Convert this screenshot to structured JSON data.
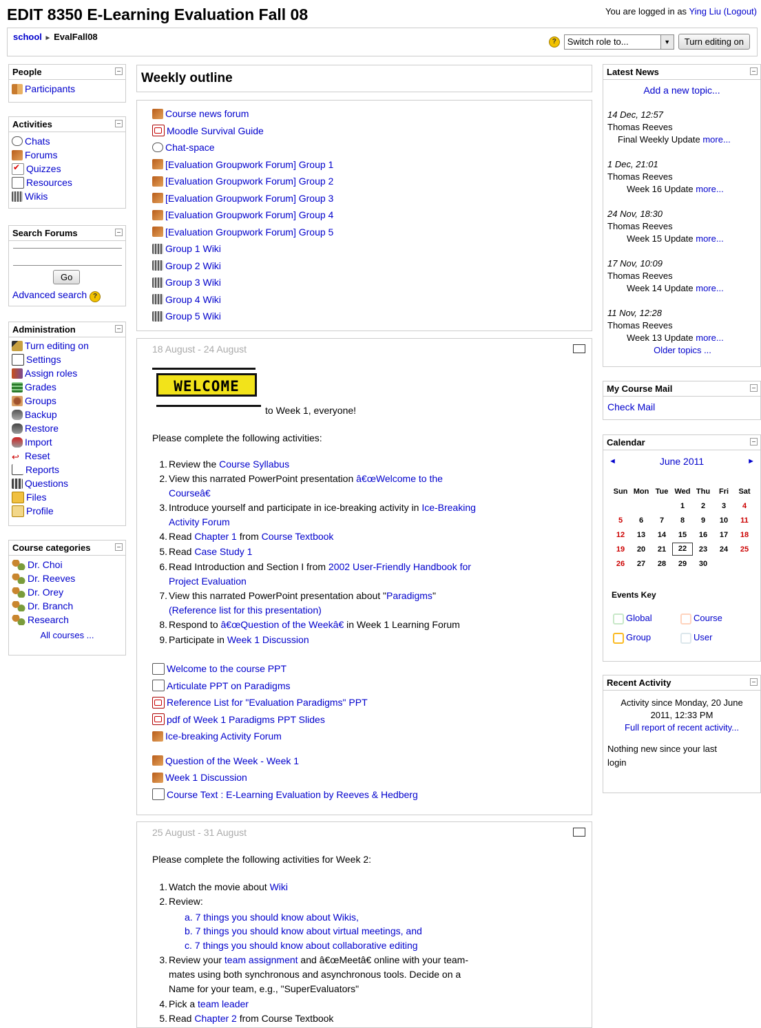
{
  "page": {
    "title": "EDIT 8350 E-Learning Evaluation Fall 08",
    "login_prefix": "You are logged in as",
    "user_name": "Ying Liu",
    "logout_label": "(Logout)"
  },
  "navbar": {
    "breadcrumb_home": "school",
    "breadcrumb_sep": "►",
    "breadcrumb_course": "EvalFall08",
    "help_glyph": "?",
    "switch_role_value": "Switch role to...",
    "turn_editing_label": "Turn editing on"
  },
  "left": {
    "people": {
      "title": "People",
      "items": [
        {
          "label": "Participants",
          "icon": "people-icon"
        }
      ]
    },
    "activities": {
      "title": "Activities",
      "items": [
        {
          "label": "Chats",
          "icon": "chat-icon"
        },
        {
          "label": "Forums",
          "icon": "forum-icon"
        },
        {
          "label": "Quizzes",
          "icon": "quiz-icon"
        },
        {
          "label": "Resources",
          "icon": "resource-icon"
        },
        {
          "label": "Wikis",
          "icon": "wiki-icon"
        }
      ]
    },
    "search": {
      "title": "Search Forums",
      "go_label": "Go",
      "advanced_label": "Advanced search"
    },
    "admin": {
      "title": "Administration",
      "items": [
        {
          "label": "Turn editing on"
        },
        {
          "label": "Settings"
        },
        {
          "label": "Assign roles"
        },
        {
          "label": "Grades"
        },
        {
          "label": "Groups"
        },
        {
          "label": "Backup"
        },
        {
          "label": "Restore"
        },
        {
          "label": "Import"
        },
        {
          "label": "Reset"
        },
        {
          "label": "Reports"
        },
        {
          "label": "Questions"
        },
        {
          "label": "Files"
        },
        {
          "label": "Profile"
        }
      ]
    },
    "categories": {
      "title": "Course categories",
      "items": [
        {
          "label": "Dr. Choi"
        },
        {
          "label": "Dr. Reeves"
        },
        {
          "label": "Dr. Orey"
        },
        {
          "label": "Dr. Branch"
        },
        {
          "label": "Research"
        }
      ],
      "all_label": "All courses ..."
    }
  },
  "main": {
    "outline_title": "Weekly outline",
    "section0": [
      {
        "label": "Course news forum",
        "icon": "forum-icon"
      },
      {
        "label": "Moodle Survival Guide",
        "icon": "pdf-icon"
      },
      {
        "label": "Chat-space",
        "icon": "chat-icon"
      },
      {
        "label": "[Evaluation Groupwork Forum] Group 1",
        "icon": "forum-icon"
      },
      {
        "label": "[Evaluation Groupwork Forum] Group 2",
        "icon": "forum-icon"
      },
      {
        "label": "[Evaluation Groupwork Forum] Group 3",
        "icon": "forum-icon"
      },
      {
        "label": "[Evaluation Groupwork Forum] Group 4",
        "icon": "forum-icon"
      },
      {
        "label": "[Evaluation Groupwork Forum] Group 5",
        "icon": "forum-icon"
      },
      {
        "label": "Group 1 Wiki",
        "icon": "wiki-icon"
      },
      {
        "label": "Group 2 Wiki",
        "icon": "wiki-icon"
      },
      {
        "label": "Group 3 Wiki",
        "icon": "wiki-icon"
      },
      {
        "label": "Group 4 Wiki",
        "icon": "wiki-icon"
      },
      {
        "label": "Group 5 Wiki",
        "icon": "wiki-icon"
      }
    ],
    "week1": {
      "date": "18 August - 24 August",
      "welcome_word": "WELCOME",
      "welcome_text": "to Week 1, everyone!",
      "intro": "Please complete the following activities:",
      "tasks": {
        "t1_pre": "Review the ",
        "t1_link": "Course Syllabus",
        "t2_pre": "View this narrated PowerPoint presentation ",
        "t2_link1": "â€œWelcome to the",
        "t2_link2": "Courseâ€",
        "t3_pre": "Introduce yourself and participate in ice-breaking activity in ",
        "t3_link1": "Ice-Breaking",
        "t3_link2": "Activity Forum",
        "t4_pre": "Read ",
        "t4_link1": "Chapter 1",
        "t4_mid": " from ",
        "t4_link2": "Course Textbook",
        "t5_pre": "Read ",
        "t5_link": "Case Study 1",
        "t6_pre": "Read Introduction and Section I from ",
        "t6_link1": "2002 User-Friendly Handbook for",
        "t6_link2": "Project Evaluation",
        "t7_pre": "View this narrated PowerPoint presentation about \"",
        "t7_link1": "Paradigms",
        "t7_post": "\"",
        "t7_link2": "(Reference list for this presentation)",
        "t8_pre": "Respond to ",
        "t8_link": "â€œQuestion of the Weekâ€",
        "t8_post": " in Week 1 Learning Forum",
        "t9_pre": "Participate in ",
        "t9_link": "Week 1 Discussion"
      },
      "resources": [
        {
          "label": "Welcome to the course PPT",
          "icon": "resource-icon"
        },
        {
          "label": "Articulate PPT on Paradigms",
          "icon": "resource-icon"
        },
        {
          "label": "Reference List for \"Evaluation Paradigms\" PPT",
          "icon": "pdf-icon"
        },
        {
          "label": "pdf of Week 1 Paradigms PPT Slides",
          "icon": "pdf-icon"
        },
        {
          "label": "Ice-breaking Activity Forum",
          "icon": "forum-icon"
        },
        {
          "label": "Question of the Week - Week 1",
          "icon": "forum-icon"
        },
        {
          "label": "Week 1 Discussion",
          "icon": "forum-icon"
        },
        {
          "label": "Course Text : E-Learning Evaluation by Reeves & Hedberg",
          "icon": "resource-icon"
        }
      ]
    },
    "week2": {
      "date": "25 August - 31 August",
      "intro": "Please complete the following activities for Week 2:",
      "t1_pre": "Watch the movie about ",
      "t1_link": "Wiki",
      "t2": "Review:",
      "sub_a": "a. 7 things you should know about Wikis,",
      "sub_b": "b. 7 things you should know about virtual meetings, and",
      "sub_c": "c. 7 things you should know about collaborative editing",
      "t3_pre": "Review your ",
      "t3_link": "team assignment",
      "t3_mid": " and â€œMeetâ€ online with your team-",
      "t3_l2": "mates using both synchronous and asynchronous tools. Decide on a",
      "t3_l3": "Name for your team, e.g., \"SuperEvaluators\"",
      "t4_pre": "Pick a ",
      "t4_link": "team leader",
      "t5_pre": "Read ",
      "t5_link": "Chapter 2",
      "t5_post": " from Course Textbook"
    }
  },
  "right": {
    "news": {
      "title": "Latest News",
      "add_label": "Add a new topic...",
      "posts": [
        {
          "date": "14 Dec, 12:57",
          "author": "Thomas Reeves",
          "subject": "Final Weekly Update",
          "more": "more..."
        },
        {
          "date": "1 Dec, 21:01",
          "author": "Thomas Reeves",
          "subject": "Week 16 Update",
          "more": "more..."
        },
        {
          "date": "24 Nov, 18:30",
          "author": "Thomas Reeves",
          "subject": "Week 15 Update",
          "more": "more..."
        },
        {
          "date": "17 Nov, 10:09",
          "author": "Thomas Reeves",
          "subject": "Week 14 Update",
          "more": "more..."
        },
        {
          "date": "11 Nov, 12:28",
          "author": "Thomas Reeves",
          "subject": "Week 13 Update",
          "more": "more..."
        }
      ],
      "older_label": "Older topics ..."
    },
    "mail": {
      "title": "My Course Mail",
      "link": "Check Mail"
    },
    "calendar": {
      "title": "Calendar",
      "prev": "◄",
      "next": "►",
      "month": "June 2011",
      "days": [
        "Sun",
        "Mon",
        "Tue",
        "Wed",
        "Thu",
        "Fri",
        "Sat"
      ],
      "weeks": [
        [
          "",
          "",
          "",
          "1",
          "2",
          "3",
          "4"
        ],
        [
          "5",
          "6",
          "7",
          "8",
          "9",
          "10",
          "11"
        ],
        [
          "12",
          "13",
          "14",
          "15",
          "16",
          "17",
          "18"
        ],
        [
          "19",
          "20",
          "21",
          "22",
          "23",
          "24",
          "25"
        ],
        [
          "26",
          "27",
          "28",
          "29",
          "30",
          "",
          ""
        ]
      ],
      "today": "22",
      "events_key_title": "Events Key",
      "keys": [
        {
          "label": "Global",
          "color": "#c8e8c8"
        },
        {
          "label": "Course",
          "color": "#ffd3bd"
        },
        {
          "label": "Group",
          "color": "#fbbb23"
        },
        {
          "label": "User",
          "color": "#dce7ec"
        }
      ]
    },
    "recent": {
      "title": "Recent Activity",
      "since_l1": "Activity since Monday, 20 June",
      "since_l2": "2011, 12:33 PM",
      "full_report": "Full report of recent activity...",
      "nothing_l1": "Nothing new since your last",
      "nothing_l2": "login"
    }
  }
}
